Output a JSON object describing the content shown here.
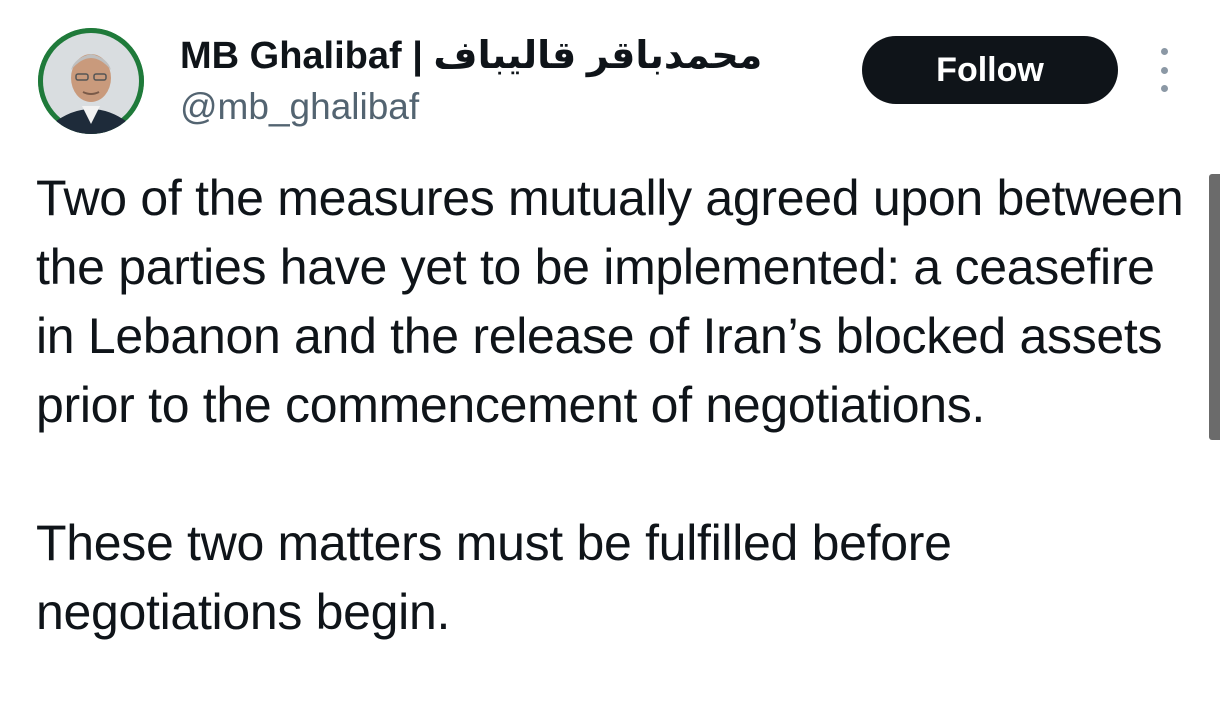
{
  "author": {
    "display_name": "MB Ghalibaf | محمدباقر قالیباف",
    "handle": "@mb_ghalibaf",
    "avatar_icon": "profile-photo"
  },
  "actions": {
    "follow_label": "Follow",
    "more_icon": "vertical-ellipsis-icon"
  },
  "tweet": {
    "paragraphs": [
      "Two of the measures mutually agreed upon between the parties have yet to be implemented: a ceasefire in Lebanon and the release of Iran’s blocked assets prior to the commencement of negotiations.",
      "These two matters must be fulfilled before negotiations begin."
    ]
  },
  "colors": {
    "text": "#0f1419",
    "secondary_text": "#536471",
    "button_bg": "#0f1419",
    "button_text": "#ffffff",
    "avatar_ring": "#1f7a3a"
  }
}
